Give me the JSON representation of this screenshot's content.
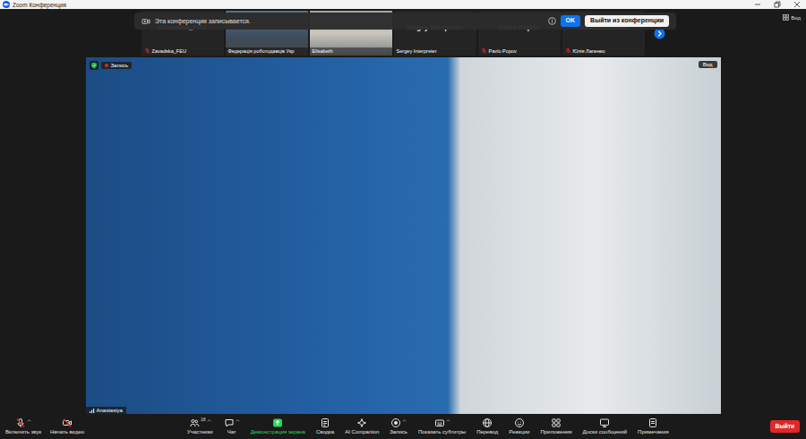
{
  "window": {
    "title": "Zoom Конференция"
  },
  "notification": {
    "text": "Эта конференция записывается.",
    "ok_button": "OK",
    "leave_button": "Выйти из конференции"
  },
  "gallery": {
    "view_button": "Вид",
    "tiles": [
      {
        "kind": "avatar",
        "name": "Zavadska_FEU",
        "label": "Zavadska_FEU",
        "muted": true
      },
      {
        "kind": "video",
        "label": "Федерація роботодавців Укр",
        "muted": false
      },
      {
        "kind": "video",
        "label": "Elisabeth",
        "muted": false
      },
      {
        "kind": "avatar",
        "name": "Sergey Interpreter",
        "label": "Sergey Interpreter",
        "muted": false
      },
      {
        "kind": "avatar",
        "name": "Pavlo Popov",
        "label": "Pavlo Popov",
        "muted": true
      },
      {
        "kind": "avatar",
        "name": "Юлія Лапенко",
        "label": "Юлія Лапенко",
        "muted": true
      }
    ]
  },
  "main_video": {
    "name": "Anastasiya",
    "recording_badge": "Запись",
    "view_button": "Вид"
  },
  "toolbar": {
    "left": [
      {
        "kind": "audio",
        "label": "Включить звук",
        "muted": true,
        "caret": true
      },
      {
        "kind": "video",
        "label": "Начать видео",
        "muted": true,
        "caret": false
      }
    ],
    "center": [
      {
        "kind": "participants",
        "label": "Участники",
        "count": "18",
        "caret": true,
        "highlight": false
      },
      {
        "kind": "chat",
        "label": "Чат",
        "caret": true,
        "highlight": false
      },
      {
        "kind": "share",
        "label": "Демонстрация экрана",
        "caret": false,
        "highlight": true
      },
      {
        "kind": "summary",
        "label": "Сводка",
        "caret": false,
        "highlight": false
      },
      {
        "kind": "ai",
        "label": "AI Companion",
        "caret": false,
        "highlight": false
      },
      {
        "kind": "record",
        "label": "Запись",
        "caret": true,
        "highlight": false
      },
      {
        "kind": "captions",
        "label": "Показать субтитры",
        "caret": true,
        "highlight": false
      },
      {
        "kind": "translate",
        "label": "Перевод",
        "caret": false,
        "highlight": false
      },
      {
        "kind": "reactions",
        "label": "Реакции",
        "caret": false,
        "highlight": false
      },
      {
        "kind": "apps",
        "label": "Приложения",
        "caret": false,
        "highlight": false
      },
      {
        "kind": "whiteboards",
        "label": "Доски сообщений",
        "caret": false,
        "highlight": false
      },
      {
        "kind": "notes",
        "label": "Примечания",
        "caret": false,
        "highlight": false
      }
    ],
    "leave_button": "Выйти"
  }
}
